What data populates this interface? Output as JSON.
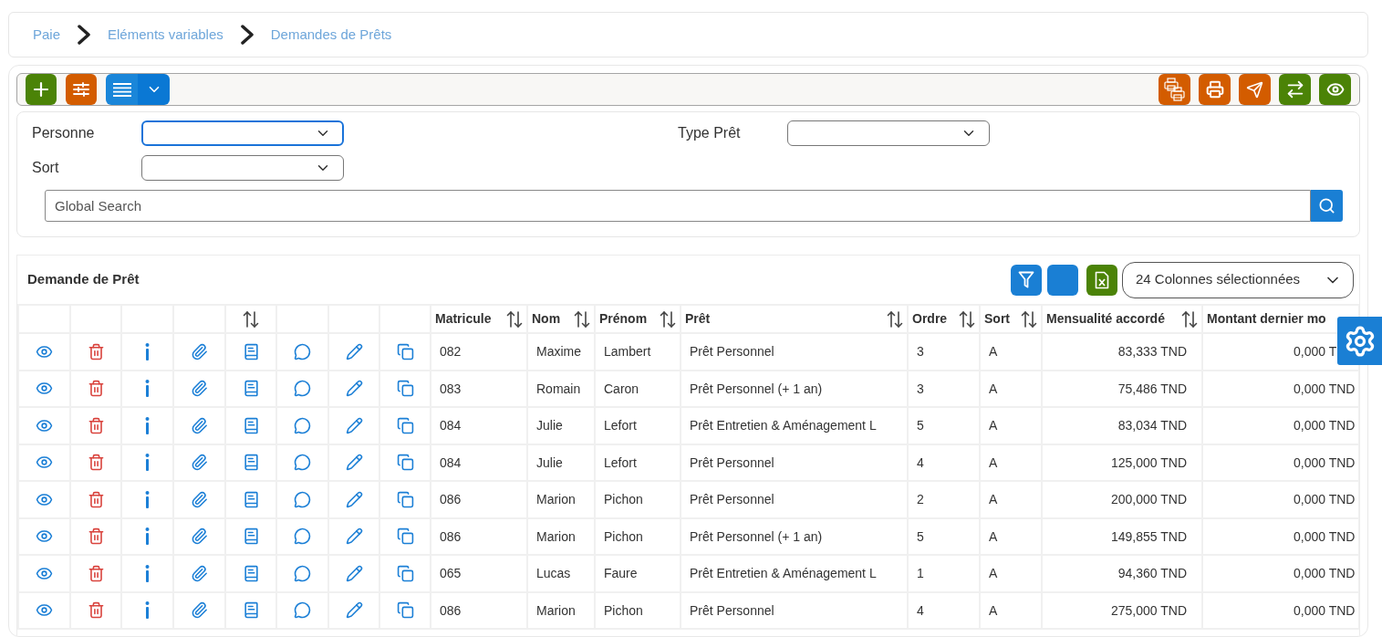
{
  "breadcrumb": [
    {
      "label": "Paie"
    },
    {
      "label": "Eléments variables"
    },
    {
      "label": "Demandes de Prêts"
    }
  ],
  "filters": {
    "fields": [
      {
        "label": "Personne",
        "focused": true
      },
      {
        "label": "Type Prêt",
        "focused": false
      },
      {
        "label": "Sort",
        "focused": false
      }
    ],
    "search": {
      "placeholder": "Global Search"
    }
  },
  "table": {
    "title": "Demande de Prêt",
    "columns_select": {
      "value": "24 Colonnes sélectionnées"
    },
    "columns": [
      {
        "kind": "action",
        "sortable": false
      },
      {
        "kind": "action",
        "sortable": false
      },
      {
        "kind": "action",
        "sortable": false
      },
      {
        "kind": "action",
        "sortable": false
      },
      {
        "kind": "action",
        "sortable": true
      },
      {
        "kind": "action",
        "sortable": false
      },
      {
        "kind": "action",
        "sortable": false
      },
      {
        "kind": "action",
        "sortable": false
      },
      {
        "kind": "data",
        "label": "Matricule",
        "sortable": true
      },
      {
        "kind": "data",
        "label": "Nom",
        "sortable": true
      },
      {
        "kind": "data",
        "label": "Prénom",
        "sortable": true
      },
      {
        "kind": "data",
        "label": "Prêt",
        "sortable": true
      },
      {
        "kind": "data",
        "label": "Ordre",
        "sortable": true
      },
      {
        "kind": "data",
        "label": "Sort",
        "sortable": true
      },
      {
        "kind": "data",
        "label": "Mensualité accordé",
        "sortable": true
      },
      {
        "kind": "data",
        "label": "Montant dernier mo",
        "sortable": false
      }
    ],
    "rows": [
      {
        "cells": [
          "082",
          "Maxime",
          "Lambert",
          "Prêt Personnel",
          "3",
          "A",
          "83,333 TND",
          "0,000 T"
        ]
      },
      {
        "cells": [
          "083",
          "Romain",
          "Caron",
          "Prêt Personnel (+ 1 an)",
          "3",
          "A",
          "75,486 TND",
          "0,000 TND"
        ]
      },
      {
        "cells": [
          "084",
          "Julie",
          "Lefort",
          "Prêt Entretien & Aménagement L",
          "5",
          "A",
          "83,034 TND",
          "0,000 TND"
        ]
      },
      {
        "cells": [
          "084",
          "Julie",
          "Lefort",
          "Prêt Personnel",
          "4",
          "A",
          "125,000 TND",
          "0,000 TND"
        ]
      },
      {
        "cells": [
          "086",
          "Marion",
          "Pichon",
          "Prêt Personnel",
          "2",
          "A",
          "200,000 TND",
          "0,000 TND"
        ]
      },
      {
        "cells": [
          "086",
          "Marion",
          "Pichon",
          "Prêt Personnel (+ 1 an)",
          "5",
          "A",
          "149,855 TND",
          "0,000 TND"
        ]
      },
      {
        "cells": [
          "065",
          "Lucas",
          "Faure",
          "Prêt Entretien & Aménagement L",
          "1",
          "A",
          "94,360 TND",
          "0,000 TND"
        ]
      },
      {
        "cells": [
          "086",
          "Marion",
          "Pichon",
          "Prêt Personnel",
          "4",
          "A",
          "275,000 TND",
          "0,000 TND"
        ]
      }
    ]
  }
}
